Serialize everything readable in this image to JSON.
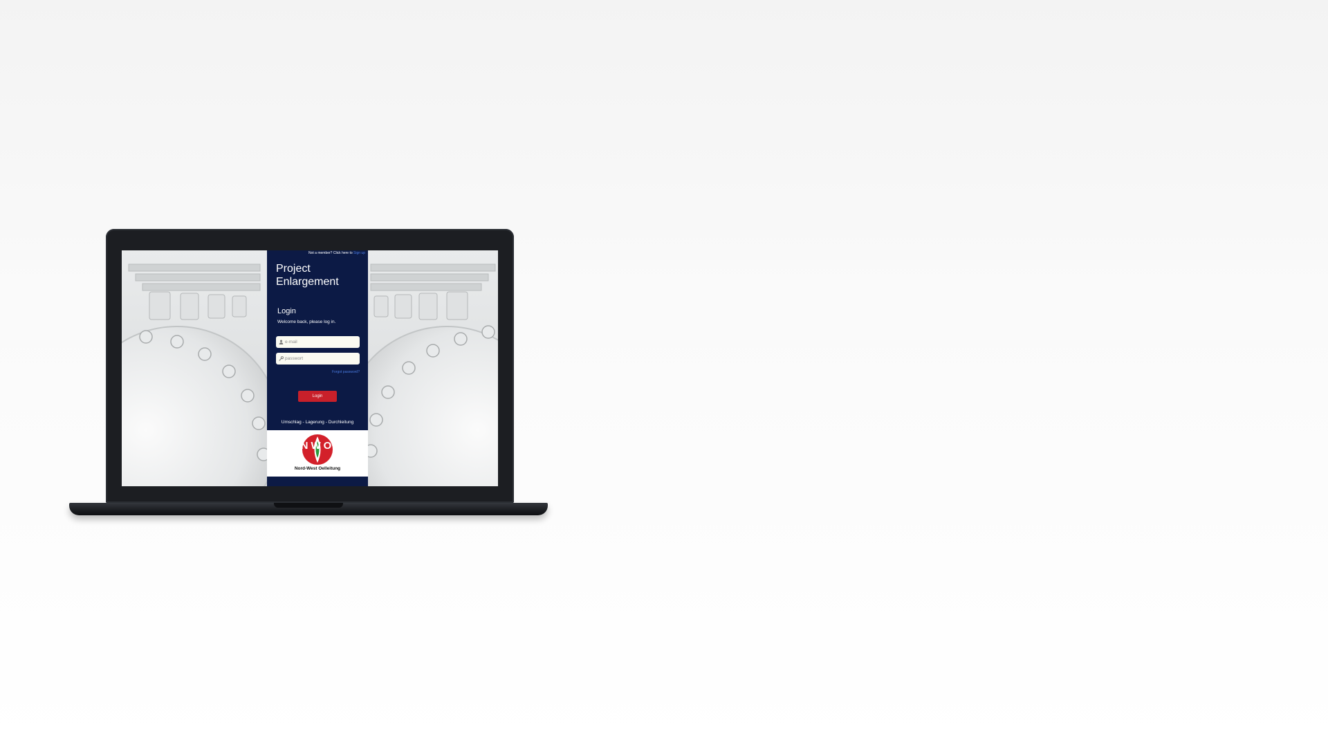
{
  "header": {
    "not_member_text": "Not a member? Click here to",
    "signup_link": "Sign up"
  },
  "app": {
    "title_line1": "Project",
    "title_line2": "Enlargement"
  },
  "login": {
    "heading": "Login",
    "welcome": "Welcome back, please log in.",
    "email_placeholder": "e-mail",
    "password_placeholder": "passwort",
    "forgot_password": "Forgot password?",
    "button_label": "Login"
  },
  "footer": {
    "tagline": "Umschlag - Lagerung - Durchleitung",
    "logo_letters": "NWO",
    "company_name": "Nord-West Oelleitung"
  },
  "colors": {
    "panel_bg": "#0c1a45",
    "accent_red": "#c8202a",
    "link_blue": "#4a7be0",
    "logo_green": "#2a9a3a"
  },
  "icons": {
    "email": "user-icon",
    "password": "key-icon"
  }
}
